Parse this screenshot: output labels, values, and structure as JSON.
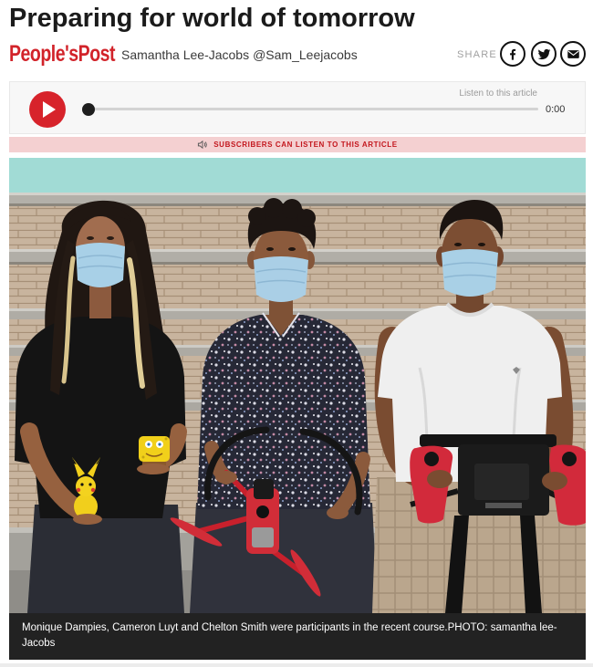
{
  "article": {
    "headline": "Preparing for world of tomorrow",
    "publication_logo": "People'sPost",
    "author": "Samantha Lee-Jacobs",
    "author_handle": "@Sam_Leejacobs"
  },
  "share": {
    "label": "SHARE",
    "buttons": [
      {
        "icon": "facebook-icon"
      },
      {
        "icon": "twitter-icon"
      },
      {
        "icon": "email-icon"
      }
    ]
  },
  "audio_player": {
    "play_icon": "play-icon",
    "listen_label": "Listen to this article",
    "time": "0:00",
    "progress": 0
  },
  "subscriber_banner": {
    "icon": "speaker-icon",
    "text": "SUBSCRIBERS CAN LISTEN TO THIS ARTICLE"
  },
  "photo": {
    "caption": "Monique Dampies, Cameron Luyt and Chelton Smith were participants in the recent course.PHOTO: samantha lee-Jacobs"
  },
  "colors": {
    "brand_red": "#d2232a",
    "play_button": "#d7232b",
    "banner_bg": "#f4d0d1",
    "banner_text": "#c3161d",
    "caption_bg": "#222222"
  }
}
